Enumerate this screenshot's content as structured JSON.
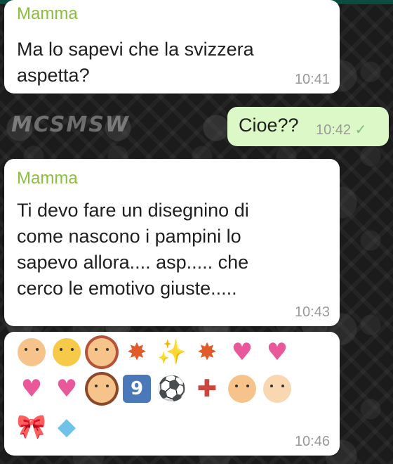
{
  "messages": [
    {
      "sender": "Mamma",
      "text": "Ma lo sapevi che la svizzera\naspetta?",
      "time": "10:41",
      "direction": "in"
    },
    {
      "text": "Cioe??",
      "time": "10:42",
      "status": "✓",
      "direction": "out"
    },
    {
      "sender": "Mamma",
      "text": "Ti devo fare un disegnino di\ncome nascono i pampini lo\nsapevo allora.... asp..... che\ncerco le emotivo giuste.....",
      "time": "10:43",
      "direction": "in"
    },
    {
      "time": "10:46",
      "direction": "in",
      "emoji_rows": [
        [
          "man-face",
          "kiss-face",
          "woman-face",
          "collision",
          "sparkles",
          "collision",
          "kiss-couple",
          "kiss-couple"
        ],
        [
          "kiss-couple",
          "kiss-couple",
          "woman-bunny",
          "keycap-9",
          "soccer-ball",
          "hospital",
          "family",
          "baby"
        ],
        [
          "ribbon",
          "diamond"
        ]
      ]
    }
  ],
  "watermark": "MCSMSW",
  "colors": {
    "sender": "#8bbf3b",
    "outgoing_bubble": "#dcf8c6",
    "header": "#0b4c40"
  }
}
